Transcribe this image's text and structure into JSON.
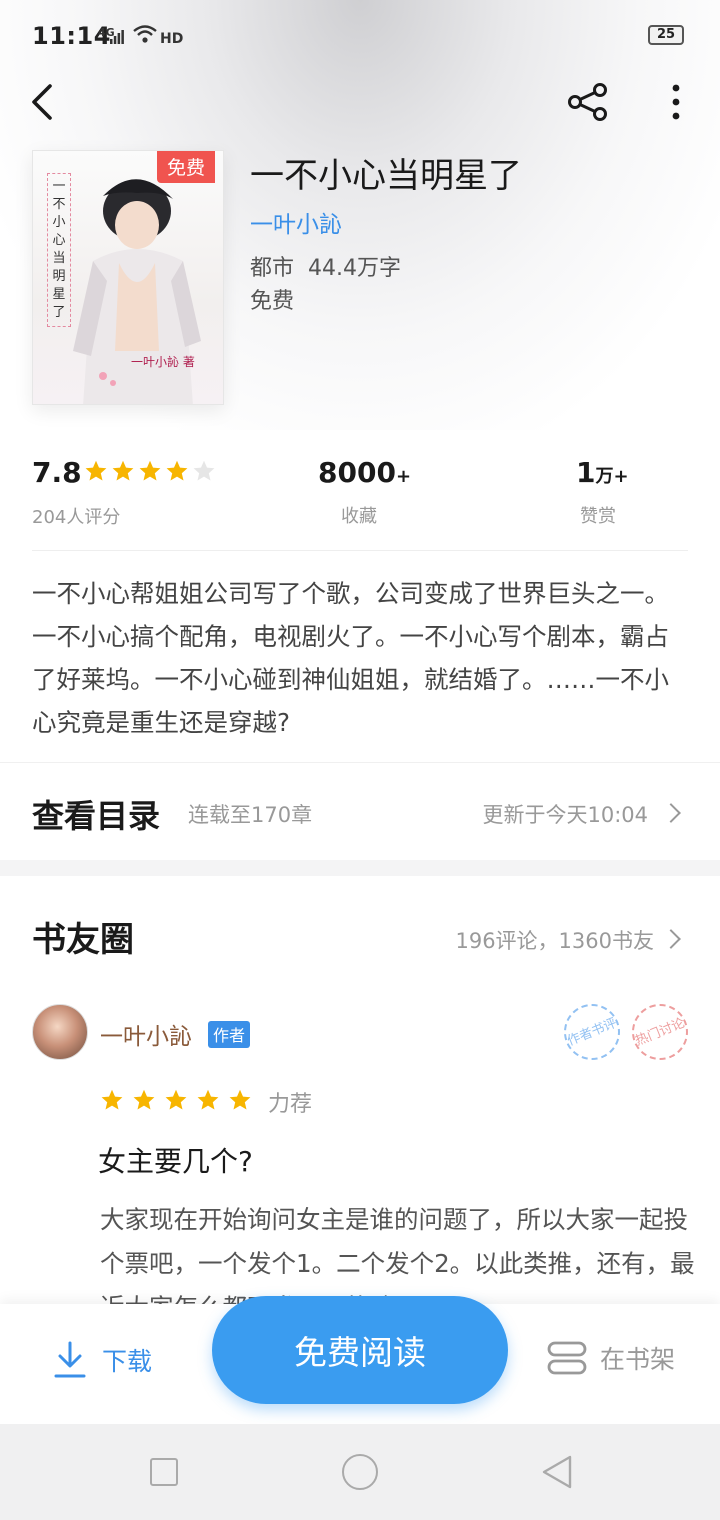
{
  "status_bar": {
    "time": "11:14",
    "network": "4G",
    "hd": "HD",
    "battery": "25"
  },
  "toolbar": {
    "back_icon": "chevron-left-icon",
    "share_icon": "share-icon",
    "more_icon": "more-vertical-icon"
  },
  "book": {
    "cover_badge": "免费",
    "cover_vertical_title": "一不小心当明星了",
    "cover_author": "一叶小訫 著",
    "title": "一不小心当明星了",
    "author": "一叶小訫",
    "genre": "都市",
    "word_count": "44.4万字",
    "price": "免费"
  },
  "stats": {
    "score": "7.8",
    "rating_stars": 4,
    "rating_max": 5,
    "rating_count_label": "204人评分",
    "favorites_value": "8000",
    "favorites_suffix": "+",
    "favorites_label": "收藏",
    "tips_value": "1",
    "tips_suffix": "万+",
    "tips_label": "赞赏"
  },
  "synopsis": "一不小心帮姐姐公司写了个歌，公司变成了世界巨头之一。一不小心搞个配角，电视剧火了。一不小心写个剧本，霸占了好莱坞。一不小心碰到神仙姐姐，就结婚了。……一不小心究竟是重生还是穿越?",
  "catalog": {
    "title": "查看目录",
    "chapter_count": "连载至170章",
    "updated": "更新于今天10:04"
  },
  "book_circle": {
    "title": "书友圈",
    "stats": "196评论，1360书友",
    "comment": {
      "author": "一叶小訫",
      "author_badge": "作者",
      "stamp_author": "作者书评",
      "stamp_hot": "热门讨论",
      "stars": 5,
      "recommend_label": "力荐",
      "title": "女主要几个?",
      "body": "大家现在开始询问女主是谁的问题了，所以大家一起投个票吧，一个发个1。二个发个2。以此类推，还有，最近大家怎么都不发需要的歌"
    }
  },
  "action_bar": {
    "download_label": "下载",
    "read_label": "免费阅读",
    "shelf_label": "在书架"
  },
  "colors": {
    "accent": "#3a9cf0",
    "link": "#3a8fe8",
    "star": "#f7b500",
    "badge_red": "#f0544f"
  }
}
